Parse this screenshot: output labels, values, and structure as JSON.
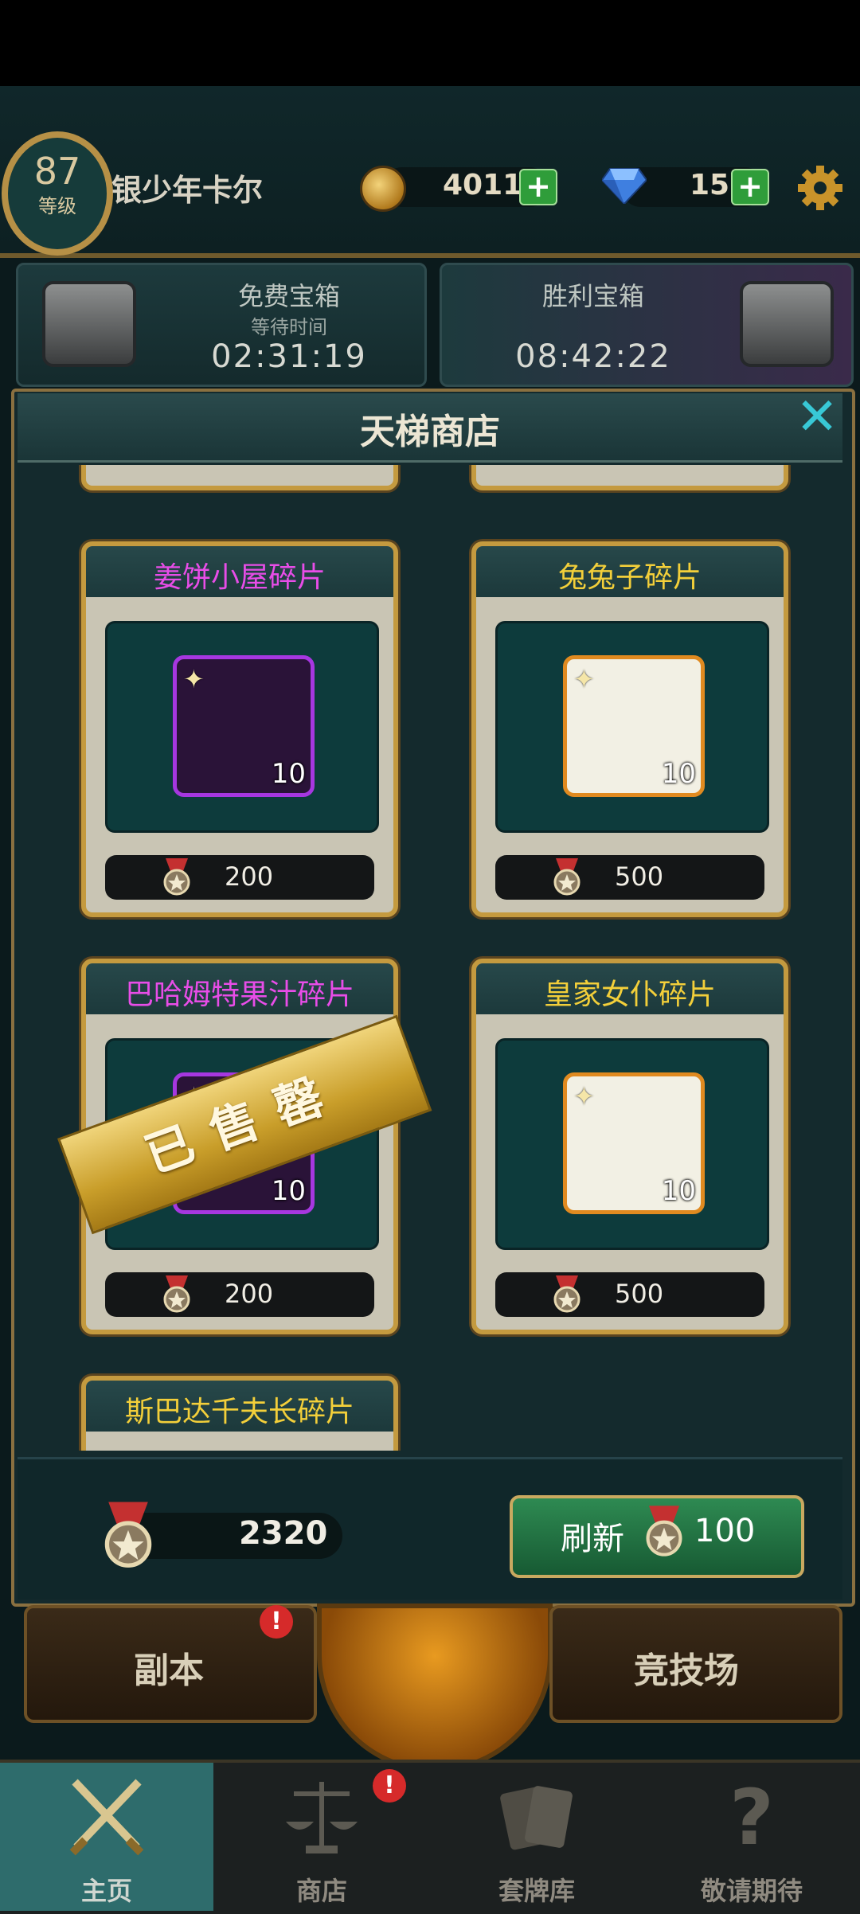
{
  "player": {
    "level": "87",
    "level_label": "等级",
    "name": "银少年卡尔"
  },
  "resources": {
    "coins": "4011",
    "gems": "15",
    "plus": "+"
  },
  "chests": {
    "free": {
      "title": "免费宝箱",
      "subtitle": "等待时间",
      "time": "02:31:19"
    },
    "victory": {
      "title": "胜利宝箱",
      "time": "08:42:22"
    }
  },
  "shop": {
    "title": "天梯商店",
    "close": "✕",
    "items": [
      {
        "title": "姜饼小屋碎片",
        "title_color": "#e84de8",
        "count": "10",
        "price": "200",
        "rarity": "purple",
        "sold": false
      },
      {
        "title": "兔兔子碎片",
        "title_color": "#f3cf3a",
        "count": "10",
        "price": "500",
        "rarity": "orange",
        "sold": false
      },
      {
        "title": "巴哈姆特果汁碎片",
        "title_color": "#e84de8",
        "count": "10",
        "price": "200",
        "rarity": "purple",
        "sold": true
      },
      {
        "title": "皇家女仆碎片",
        "title_color": "#f3cf3a",
        "count": "10",
        "price": "500",
        "rarity": "orange",
        "sold": false
      },
      {
        "title": "斯巴达千夫长碎片",
        "title_color": "#f3cf3a"
      }
    ],
    "sold_label": "已售罄",
    "currency": "2320",
    "refresh_label": "刷新",
    "refresh_cost": "100"
  },
  "modes": {
    "dungeon": "副本",
    "arena": "竞技场",
    "badge": "!"
  },
  "nav": [
    {
      "label": "主页",
      "icon": "crossed-swords-icon",
      "active": true
    },
    {
      "label": "商店",
      "icon": "scales-icon",
      "active": false
    },
    {
      "label": "套牌库",
      "icon": "cards-icon",
      "active": false
    },
    {
      "label": "敬请期待",
      "icon": "question-icon",
      "active": false
    }
  ],
  "colors": {
    "gold_border": "#c49a3f",
    "accent_cyan": "#38c8d6",
    "button_green": "#2e8a52"
  }
}
